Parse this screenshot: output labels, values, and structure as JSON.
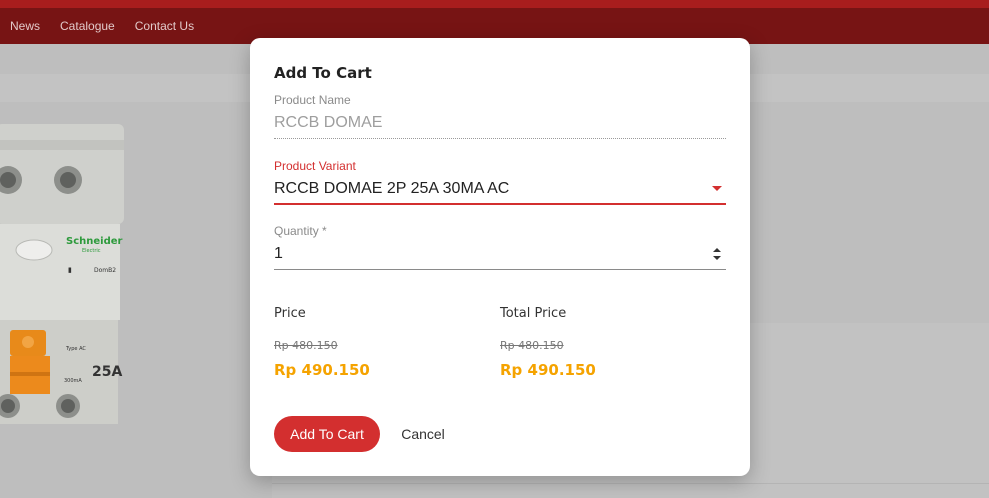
{
  "nav": {
    "items": [
      "News",
      "Catalogue",
      "Contact Us"
    ]
  },
  "product_image": {
    "brand": "Schneider",
    "brand_sub": "Electric",
    "model": "DomB2",
    "rating": "25A",
    "sensitivity": "300mA",
    "type": "Type AC"
  },
  "modal": {
    "title": "Add To Cart",
    "product_name": {
      "label": "Product Name",
      "value": "RCCB DOMAE"
    },
    "product_variant": {
      "label": "Product Variant",
      "value": "RCCB DOMAE 2P 25A 30MA AC"
    },
    "quantity": {
      "label": "Quantity *",
      "value": "1"
    },
    "price": {
      "label": "Price",
      "original": "Rp 480.150",
      "current": "Rp 490.150"
    },
    "total_price": {
      "label": "Total Price",
      "original": "Rp 480.150",
      "current": "Rp 490.150"
    },
    "add_button": "Add To Cart",
    "cancel_button": "Cancel"
  },
  "colors": {
    "accent_red": "#d32f2f",
    "nav_bg": "#771414",
    "price_orange": "#f5a300"
  }
}
